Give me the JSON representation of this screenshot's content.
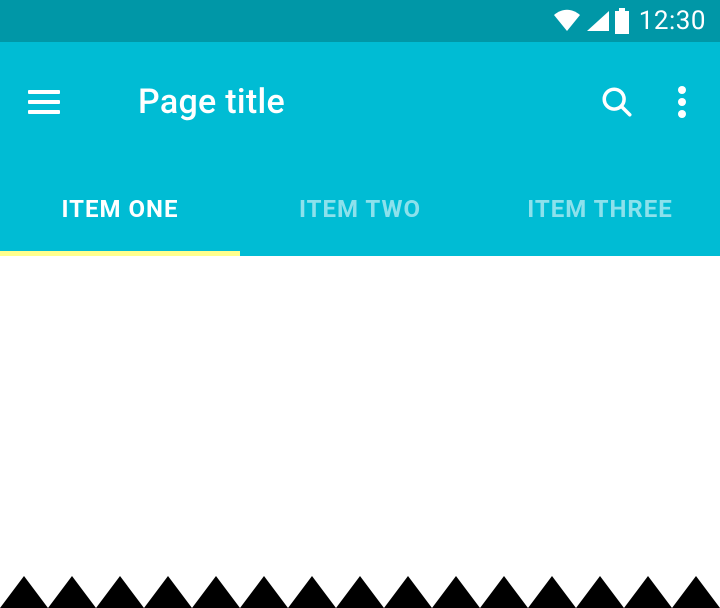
{
  "status": {
    "time": "12:30"
  },
  "appbar": {
    "title": "Page title"
  },
  "tabs": [
    {
      "label": "ITEM ONE",
      "active": true
    },
    {
      "label": "ITEM TWO",
      "active": false
    },
    {
      "label": "ITEM THREE",
      "active": false
    }
  ]
}
